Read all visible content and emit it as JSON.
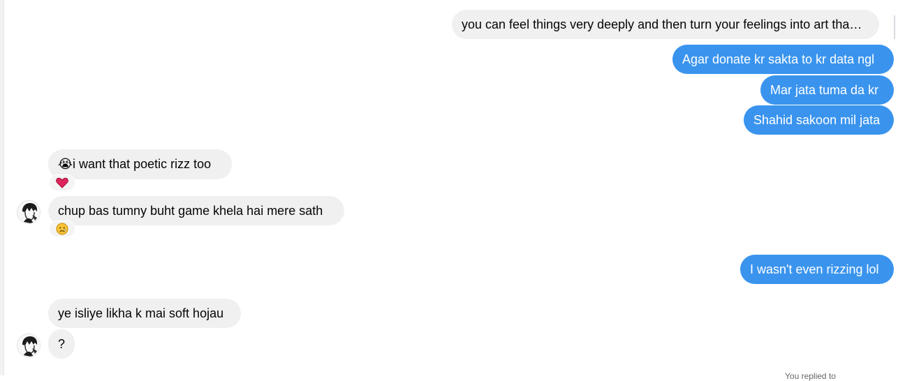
{
  "messages": [
    {
      "id": "m1",
      "direction": "outgoing",
      "text": "you can feel things very deeply and then turn your feelings into art tha…"
    },
    {
      "id": "m2",
      "direction": "outgoing",
      "text": "Agar donate kr sakta to kr data ngl"
    },
    {
      "id": "m3",
      "direction": "outgoing",
      "text": "Mar jata tuma da kr"
    },
    {
      "id": "m4",
      "direction": "outgoing",
      "text": "Shahid sakoon mil jata"
    },
    {
      "id": "m5",
      "direction": "incoming",
      "emoji": "😭",
      "text": "i want that poetic rizz too",
      "reaction": "❤️"
    },
    {
      "id": "m6",
      "direction": "incoming",
      "text": "chup bas tumny buht game khela hai mere sath",
      "reaction": "😥"
    },
    {
      "id": "m7",
      "direction": "outgoing",
      "text": "I wasn't even rizzing lol"
    },
    {
      "id": "m8",
      "direction": "incoming",
      "text": "ye isliye likha k mai soft hojau"
    },
    {
      "id": "m9",
      "direction": "incoming",
      "text": "?"
    }
  ],
  "footer_cut_text": "You replied to",
  "icons": {
    "reaction_heart": "red-heart-icon",
    "reaction_sad": "sad-relieved-face-icon",
    "avatar": "anime-character-avatar"
  },
  "colors": {
    "outgoing_bubble": "#3a94ee",
    "incoming_bubble": "#f0f0f0",
    "outgoing_text": "#ffffff",
    "incoming_text": "#050505"
  }
}
